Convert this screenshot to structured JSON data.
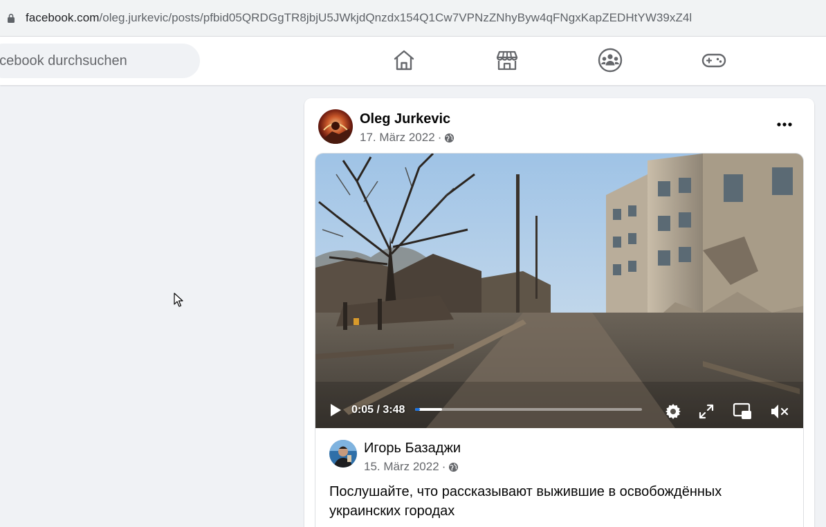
{
  "browser": {
    "url_host": "facebook.com",
    "url_path": "/oleg.jurkevic/posts/pfbid05QRDGgTR8jbjU5JWkjdQnzdx154Q1Cw7VPNzZNhyByw4qFNgxKapZEDHtYW39xZ4l"
  },
  "header": {
    "search_placeholder": "acebook durchsuchen",
    "nav": [
      "home-icon",
      "marketplace-icon",
      "groups-icon",
      "gaming-icon"
    ]
  },
  "post": {
    "author": "Oleg Jurkevic",
    "date": "17. März 2022",
    "separator": "·",
    "privacy_icon": "globe-icon",
    "more_icon": "more-options-icon",
    "video": {
      "current_time": "0:05",
      "slash": "/",
      "duration": "3:48",
      "progress_played": 0.02,
      "progress_buffered": 0.12,
      "controls": [
        "play-icon",
        "settings-icon",
        "fullscreen-icon",
        "picture-in-picture-icon",
        "mute-icon"
      ]
    },
    "shared": {
      "author": "Игорь Базаджи",
      "date": "15. März 2022",
      "separator": "·",
      "text": "Послушайте, что рассказывают выжившие в освобождённых украинских городах"
    }
  },
  "colors": {
    "accent": "#1b74e4",
    "page_bg": "#f0f2f5",
    "card_bg": "#ffffff",
    "secondary_text": "#65676b"
  }
}
